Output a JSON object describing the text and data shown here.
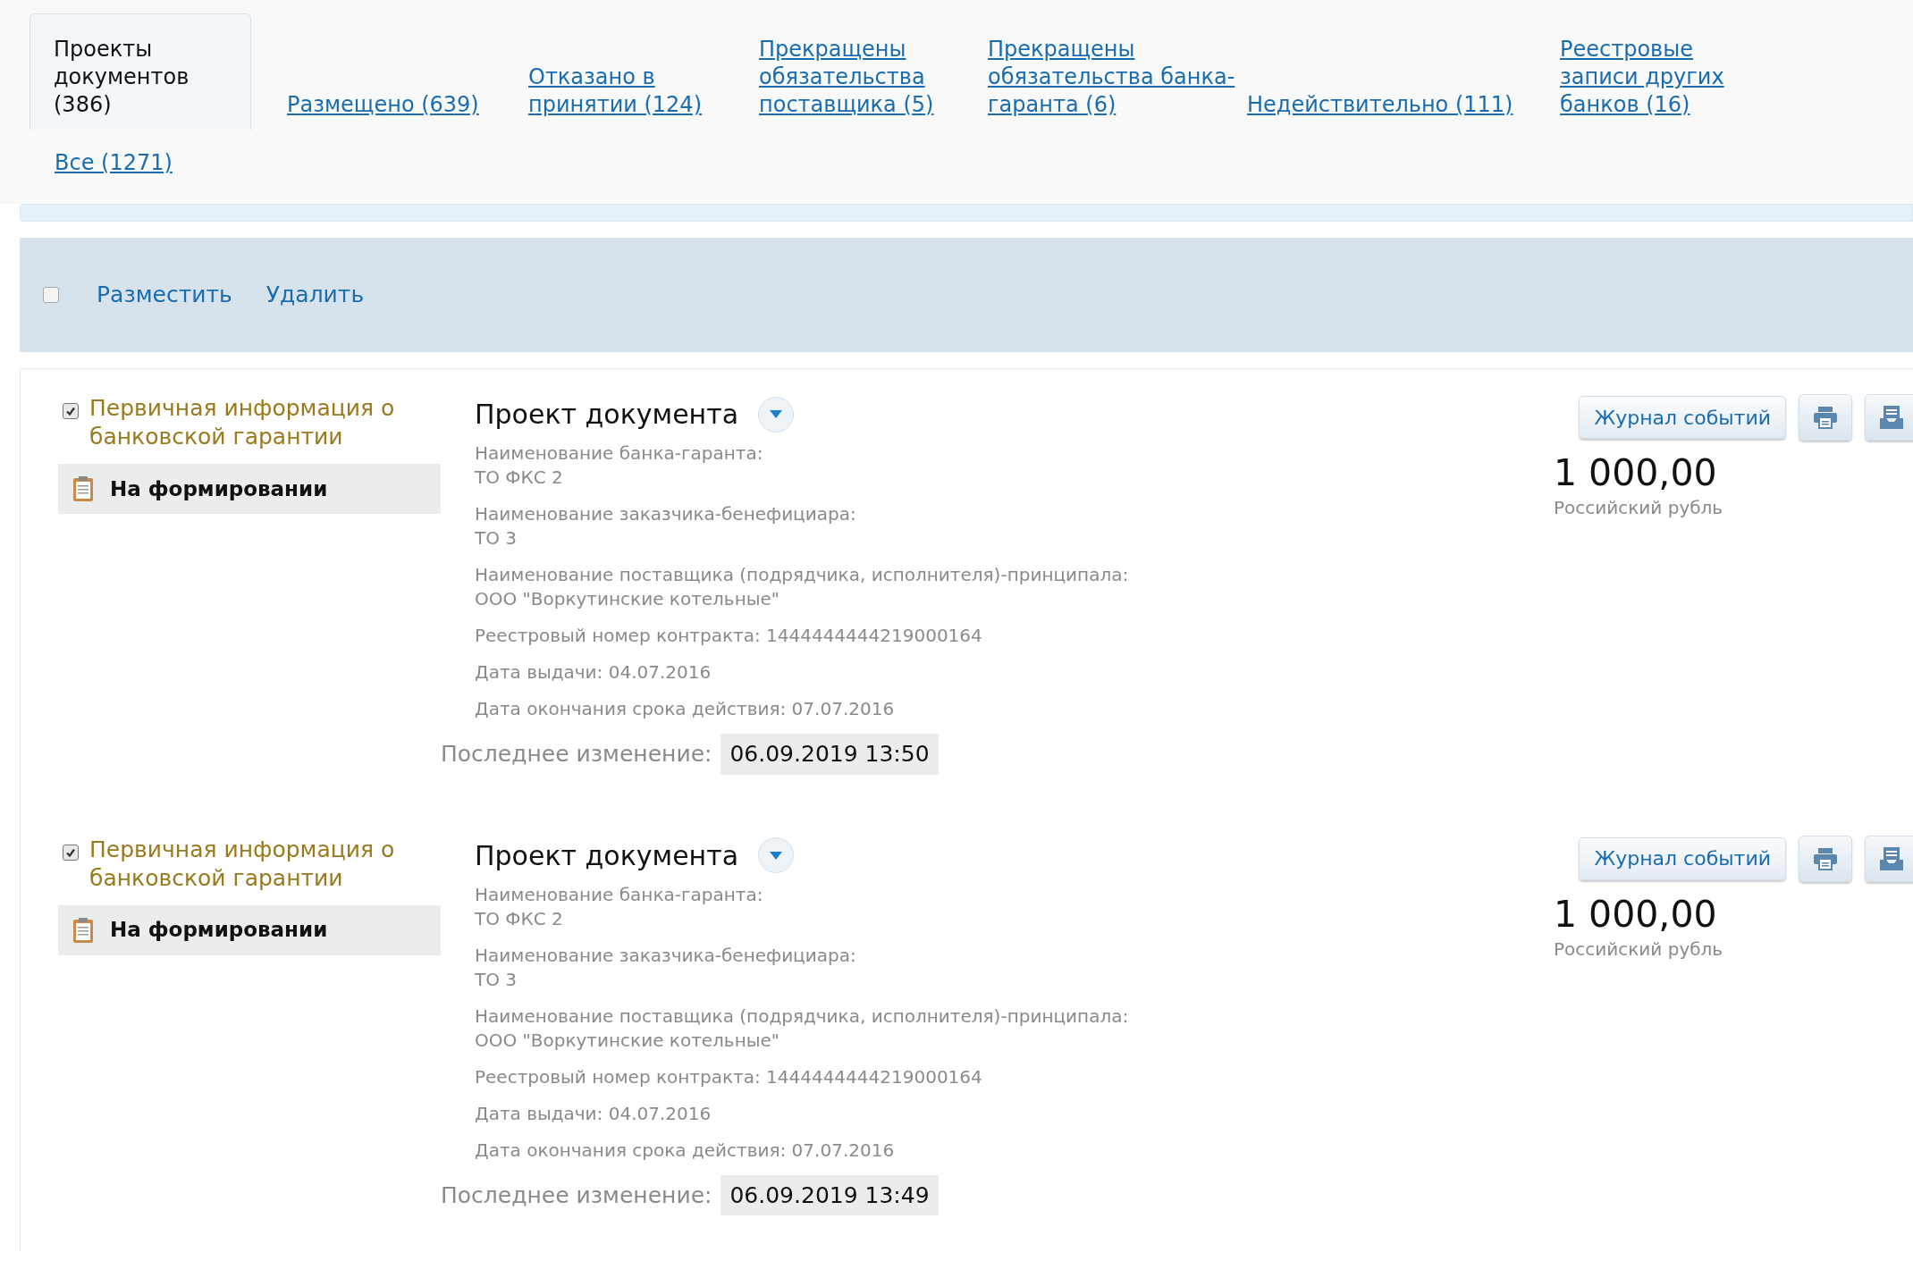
{
  "tabs": [
    {
      "label": "Проекты документов (386)",
      "selected": true
    },
    {
      "label": "Размещено (639)",
      "selected": false
    },
    {
      "label": "Отказано в принятии (124)",
      "selected": false
    },
    {
      "label": "Прекращены обязательства поставщика (5)",
      "selected": false
    },
    {
      "label": "Прекращены обязательства банка-гаранта (6)",
      "selected": false
    },
    {
      "label": "Недействительно (111)",
      "selected": false
    },
    {
      "label": "Реестровые записи других банков (16)",
      "selected": false
    },
    {
      "label": "Все (1271)",
      "selected": false
    }
  ],
  "toolbar": {
    "select_all": {
      "checked": false
    },
    "actions": [
      "Разместить",
      "Удалить"
    ]
  },
  "records": [
    {
      "checked": true,
      "type": "Первичная информация о банковской гарантии",
      "status": "На формировании",
      "title": "Проект документа",
      "fields": [
        {
          "label": "Наименование банка-гаранта:",
          "value": "ТО ФКС 2"
        },
        {
          "label": "Наименование заказчика-бенефициара:",
          "value": "ТО 3"
        },
        {
          "label": "Наименование поставщика (подрядчика, исполнителя)-принципала:",
          "value": "ООО \"Воркутинские котельные\""
        },
        {
          "label": "Реестровый номер контракта: 1444444444219000164"
        },
        {
          "label": "Дата выдачи: 04.07.2016"
        },
        {
          "label": "Дата окончания срока действия: 07.07.2016"
        }
      ],
      "last_change_label": "Последнее изменение:",
      "last_change": "06.09.2019 13:50",
      "journal_button": "Журнал событий",
      "amount": "1 000,00",
      "currency": "Российский рубль"
    },
    {
      "checked": true,
      "type": "Первичная информация о банковской гарантии",
      "status": "На формировании",
      "title": "Проект документа",
      "fields": [
        {
          "label": "Наименование банка-гаранта:",
          "value": "ТО ФКС 2"
        },
        {
          "label": "Наименование заказчика-бенефициара:",
          "value": "ТО 3"
        },
        {
          "label": "Наименование поставщика (подрядчика, исполнителя)-принципала:",
          "value": "ООО \"Воркутинские котельные\""
        },
        {
          "label": "Реестровый номер контракта: 1444444444219000164"
        },
        {
          "label": "Дата выдачи: 04.07.2016"
        },
        {
          "label": "Дата окончания срока действия: 07.07.2016"
        }
      ],
      "last_change_label": "Последнее изменение:",
      "last_change": "06.09.2019 13:49",
      "journal_button": "Журнал событий",
      "amount": "1 000,00",
      "currency": "Российский рубль"
    }
  ]
}
